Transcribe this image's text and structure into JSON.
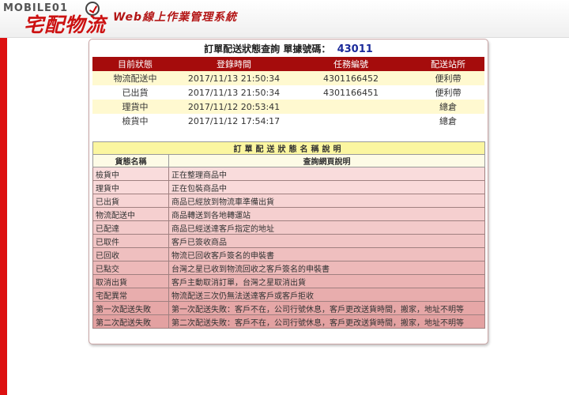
{
  "header": {
    "logo_top": "MOBILE01",
    "logo_main": "宅配物流",
    "system_title": "Web線上作業管理系統"
  },
  "query": {
    "title": "訂單配送狀態查詢",
    "ref_label": "單據號碼：",
    "ref_number": "43011"
  },
  "status_table": {
    "headers": [
      "目前狀態",
      "登錄時間",
      "任務編號",
      "配送站所"
    ],
    "rows": [
      [
        "物流配送中",
        "2017/11/13 21:50:34",
        "4301166452",
        "便利帶"
      ],
      [
        "已出貨",
        "2017/11/13 21:50:34",
        "4301166451",
        "便利帶"
      ],
      [
        "理貨中",
        "2017/11/12 20:53:41",
        "",
        "總倉"
      ],
      [
        "檢貨中",
        "2017/11/12 17:54:17",
        "",
        "總倉"
      ]
    ]
  },
  "desc_table": {
    "caption": "訂單配送狀態名稱說明",
    "headers": [
      "貨態名稱",
      "查詢網頁說明"
    ],
    "rows": [
      [
        "檢貨中",
        "正在整理商品中"
      ],
      [
        "理貨中",
        "正在包裝商品中"
      ],
      [
        "已出貨",
        "商品已經放到物流車準備出貨"
      ],
      [
        "物流配送中",
        "商品轉送到各地轉運站"
      ],
      [
        "已配達",
        "商品已經送達客戶指定的地址"
      ],
      [
        "已取件",
        "客戶已簽收商品"
      ],
      [
        "已回收",
        "物流已回收客戶簽名的申裝書"
      ],
      [
        "已點交",
        "台灣之星已收到物流回收之客戶簽名的申裝書"
      ],
      [
        "取消出貨",
        "客戶主動取消訂單，台灣之星取消出貨"
      ],
      [
        "宅配異常",
        "物流配送三次仍無法送達客戶或客戶拒收"
      ],
      [
        "第一次配送失敗",
        "第一次配送失敗：客戶不在，公司行號休息，客戶更改送貨時間，搬家，地址不明等"
      ],
      [
        "第二次配送失敗",
        "第二次配送失敗：客戶不在，公司行號休息，客戶更改送貨時間，搬家，地址不明等"
      ]
    ],
    "row_colors": [
      "#f9dcdc",
      "#f9d9d9",
      "#f7d4d4",
      "#f5cfcf",
      "#f3caca",
      "#f1c5c5",
      "#efbfbf",
      "#edb9b9",
      "#ebb3b3",
      "#e8adad",
      "#e6a7a7",
      "#e3a1a1"
    ]
  },
  "colors": {
    "accent": "#a50c0c",
    "sidebar": "#dd1010",
    "logo": "#cc1111",
    "ref_number": "#1a2a9a"
  }
}
